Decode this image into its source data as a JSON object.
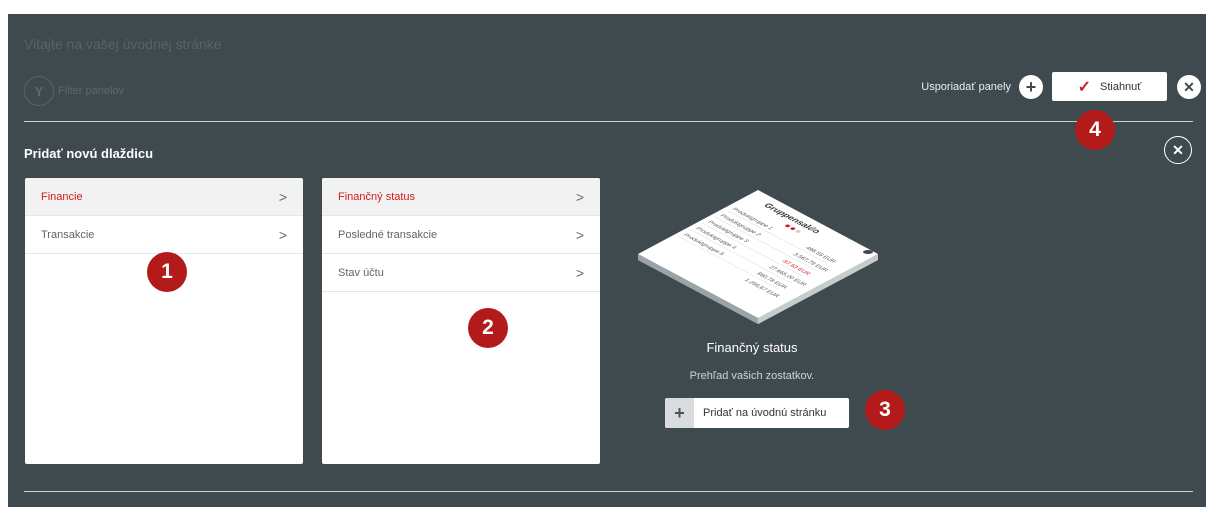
{
  "header": {
    "welcome": "Vitajte na vašej úvodnej stránke",
    "filter_label": "Filter panelov",
    "arrange_label": "Usporiadať panely",
    "save_label": "Stiahnuť"
  },
  "add_tile": {
    "title": "Pridať novú dlaždicu"
  },
  "categories": [
    {
      "label": "Financie"
    },
    {
      "label": "Transakcie"
    }
  ],
  "subcategories": [
    {
      "label": "Finančný status"
    },
    {
      "label": "Posledné transakcie"
    },
    {
      "label": "Stav účtu"
    }
  ],
  "preview": {
    "title": "Finančný status",
    "description": "Prehľad vašich zostatkov.",
    "add_button_label": "Pridať na úvodnú stránku",
    "widget_title": "Gruppensaldo",
    "rows": [
      {
        "label": "Produktgruppe 1",
        "value": "498,55 EUR"
      },
      {
        "label": "Produktgruppe 2",
        "value": "3.567,79 EUR"
      },
      {
        "label": "Produktgruppe 3",
        "value": "-97,63 EUR"
      },
      {
        "label": "Produktgruppe 4",
        "value": "27.665,00 EUR"
      },
      {
        "label": "Produktgruppe 5",
        "value": "890,78 EUR"
      },
      {
        "label": "",
        "value": "1.256,67 EUR"
      }
    ]
  },
  "badges": [
    "1",
    "2",
    "3",
    "4"
  ],
  "colors": {
    "background": "#3f4a4f",
    "accent_red": "#b31b1b",
    "active_text": "#d31c1c"
  },
  "icons": {
    "filter": "filter-icon",
    "add": "plus-icon",
    "save": "check-icon",
    "close": "close-icon",
    "chevron": "chevron-right-icon"
  }
}
